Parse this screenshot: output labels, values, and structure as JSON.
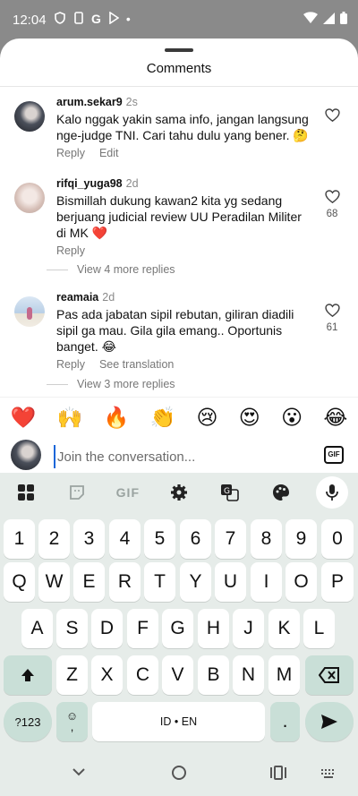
{
  "status_bar": {
    "time": "12:04",
    "dot": "•"
  },
  "sheet": {
    "title": "Comments"
  },
  "comments": [
    {
      "username": "arum.sekar9",
      "ago": "2s",
      "text": "Kalo nggak yakin sama info, jangan langsung nge-judge TNI. Cari tahu dulu yang bener. 🤔",
      "actions": [
        "Reply",
        "Edit"
      ],
      "likes": ""
    },
    {
      "username": "rifqi_yuga98",
      "ago": "2d",
      "text": "Bismillah dukung kawan2 kita yg sedang berjuang judicial review UU Peradilan Militer di MK ❤️",
      "actions": [
        "Reply"
      ],
      "likes": "68",
      "more_replies": "View 4 more replies"
    },
    {
      "username": "reamaia",
      "ago": "2d",
      "text": "Pas ada jabatan sipil rebutan, giliran diadili sipil ga mau. Gila gila emang.. Oportunis banget. 😂",
      "actions": [
        "Reply",
        "See translation"
      ],
      "likes": "61",
      "more_replies": "View 3 more replies"
    }
  ],
  "emoji_bar": [
    "❤️",
    "🙌",
    "🔥",
    "👏",
    "😢",
    "😍",
    "😮",
    "😂"
  ],
  "composer": {
    "placeholder": "Join the conversation...",
    "gif_label": "GIF"
  },
  "keyboard": {
    "toolbar": [
      "apps-icon",
      "sticker-icon",
      "GIF",
      "settings-icon",
      "translate-icon",
      "palette-icon",
      "mic-icon"
    ],
    "gif_label": "GIF",
    "row_numbers": [
      "1",
      "2",
      "3",
      "4",
      "5",
      "6",
      "7",
      "8",
      "9",
      "0"
    ],
    "row_q": [
      "Q",
      "W",
      "E",
      "R",
      "T",
      "Y",
      "U",
      "I",
      "O",
      "P"
    ],
    "row_a": [
      "A",
      "S",
      "D",
      "F",
      "G",
      "H",
      "J",
      "K",
      "L"
    ],
    "row_z": [
      "Z",
      "X",
      "C",
      "V",
      "B",
      "N",
      "M"
    ],
    "symbols_label": "?123",
    "comma_label": ",",
    "space_label": "ID • EN",
    "period_label": "."
  }
}
